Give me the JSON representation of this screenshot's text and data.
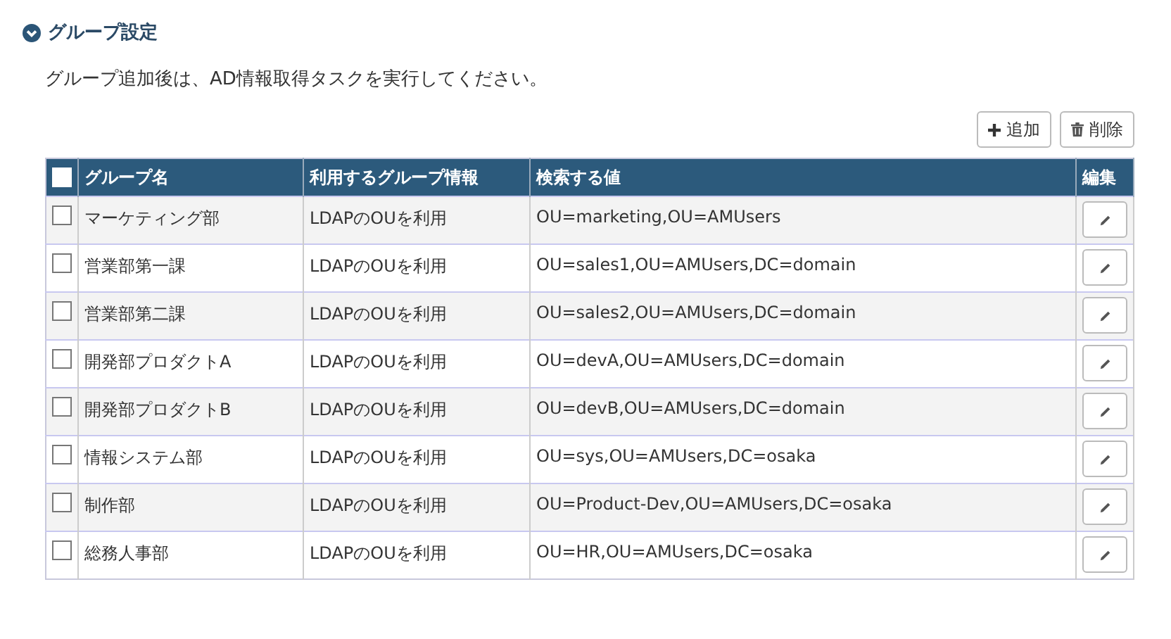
{
  "section": {
    "title": "グループ設定",
    "expanded": true
  },
  "notice": "グループ追加後は、AD情報取得タスクを実行してください。",
  "buttons": [
    {
      "kind": "add",
      "label": "追加"
    },
    {
      "kind": "delete",
      "label": "削除"
    }
  ],
  "table": {
    "select_all": {
      "checked": false
    },
    "columns": [
      "グループ名",
      "利用するグループ情報",
      "検索する値",
      "編集"
    ],
    "rows": [
      {
        "checked": false,
        "name": "マーケティング部",
        "info": "LDAPのOUを利用",
        "value": "OU=marketing,OU=AMUsers"
      },
      {
        "checked": false,
        "name": "営業部第一課",
        "info": "LDAPのOUを利用",
        "value": "OU=sales1,OU=AMUsers,DC=domain"
      },
      {
        "checked": false,
        "name": "営業部第二課",
        "info": "LDAPのOUを利用",
        "value": "OU=sales2,OU=AMUsers,DC=domain"
      },
      {
        "checked": false,
        "name": "開発部プロダクトA",
        "info": "LDAPのOUを利用",
        "value": "OU=devA,OU=AMUsers,DC=domain"
      },
      {
        "checked": false,
        "name": "開発部プロダクトB",
        "info": "LDAPのOUを利用",
        "value": "OU=devB,OU=AMUsers,DC=domain"
      },
      {
        "checked": false,
        "name": "情報システム部",
        "info": "LDAPのOUを利用",
        "value": "OU=sys,OU=AMUsers,DC=osaka"
      },
      {
        "checked": false,
        "name": "制作部",
        "info": "LDAPのOUを利用",
        "value": "OU=Product-Dev,OU=AMUsers,DC=osaka"
      },
      {
        "checked": false,
        "name": "総務人事部",
        "info": "LDAPのOUを利用",
        "value": "OU=HR,OU=AMUsers,DC=osaka"
      }
    ]
  }
}
